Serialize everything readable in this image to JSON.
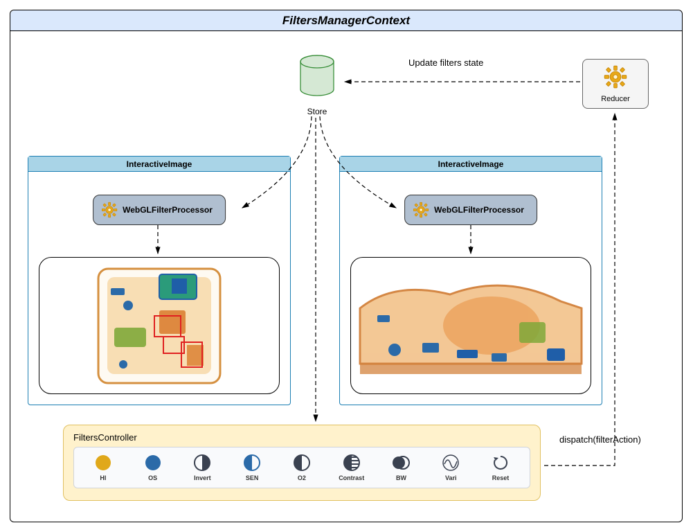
{
  "title": "FiltersManagerContext",
  "store": {
    "label": "Store"
  },
  "reducer": {
    "label": "Reducer"
  },
  "updateArrowLabel": "Update filters state",
  "dispatchLabel": "dispatch(filterAction)",
  "panels": {
    "left": {
      "title": "InteractiveImage",
      "processor": "WebGLFilterProcessor"
    },
    "right": {
      "title": "InteractiveImage",
      "processor": "WebGLFilterProcessor"
    }
  },
  "filtersController": {
    "title": "FiltersController",
    "buttons": [
      {
        "id": "hi",
        "label": "HI"
      },
      {
        "id": "os",
        "label": "OS"
      },
      {
        "id": "invert",
        "label": "Invert"
      },
      {
        "id": "sen",
        "label": "SEN"
      },
      {
        "id": "o2",
        "label": "O2"
      },
      {
        "id": "contrast",
        "label": "Contrast"
      },
      {
        "id": "bw",
        "label": "BW"
      },
      {
        "id": "vari",
        "label": "Vari"
      },
      {
        "id": "reset",
        "label": "Reset"
      }
    ]
  },
  "colors": {
    "headerBg": "#dae8fc",
    "panelBorder": "#1b7eb3",
    "panelHeader": "#a9d4e7",
    "processorBg": "#b0bfd0",
    "controllerBg": "#fff2cc",
    "storeFill": "#d5e8d4",
    "storeStroke": "#3a8f3a",
    "iconBlue": "#2b6aa8",
    "iconDark": "#3a4150",
    "iconGold": "#e0a81a"
  }
}
